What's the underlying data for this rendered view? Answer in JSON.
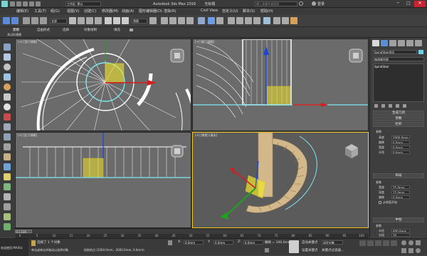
{
  "title_bar": {
    "app_title": "Autodesk 3ds Max 2016",
    "file_name": "无标题",
    "workspace": "工作区: 默认",
    "search_placeholder": "键入关键字或短语",
    "login": "登录",
    "window_controls": [
      "─",
      "□",
      "✕"
    ]
  },
  "menu": {
    "items": [
      "编辑(E)",
      "工具(T)",
      "组(G)",
      "视图(V)",
      "创建(C)",
      "修改器(M)",
      "动画(A)",
      "图形编辑器(D)",
      "渲染(R)",
      "Civil View",
      "自定义(U)",
      "脚本(S)",
      "帮助(H)"
    ]
  },
  "toolbar": {
    "dropdown_value": "全部",
    "view_dropdown": "视图"
  },
  "ribbon": {
    "tabs": [
      "建模",
      "自由形式",
      "选择",
      "对象绘制",
      "填充"
    ],
    "sub_label": "多边形建模"
  },
  "viewports": {
    "top_left": "[+] [顶] [线框]",
    "top_right": "[+] [前] [线框]",
    "bottom_left": "[+] [左] [线框]",
    "bottom_right": "[+] [透视] [真实]"
  },
  "command_panel": {
    "object_name": "SpiralStair001",
    "modifier_list": "修改器列表",
    "stack_item": "SpiralStair",
    "rollouts": {
      "generate": "生成几何",
      "parameters": "参数",
      "stringers": "栏杆",
      "layout": "布局",
      "center_pole": "中柱"
    },
    "params_group": "参数",
    "params": [
      {
        "label": "高度",
        "value": "1000.0mm"
      },
      {
        "label": "偏移",
        "value": "0.0mm"
      },
      {
        "label": "宽度",
        "value": "0.0mm"
      },
      {
        "label": "半径",
        "value": "0.0mm"
      }
    ],
    "layout_group": "参数",
    "layout_params": [
      {
        "label": "宽度",
        "value": "25.0mm"
      },
      {
        "label": "深度",
        "value": "15.0mm"
      },
      {
        "label": "偏移",
        "value": "0.0mm"
      }
    ],
    "checkbox_label": "从地面开始",
    "pole_group": "参数",
    "pole_params": [
      {
        "label": "半径",
        "value": "400.0mm"
      },
      {
        "label": "分段",
        "value": "16"
      }
    ]
  },
  "timeslider": {
    "frame_display": "0 / 100",
    "ticks": [
      "0",
      "5",
      "10",
      "15",
      "20",
      "25",
      "30",
      "35",
      "40",
      "45",
      "50",
      "55",
      "60",
      "65",
      "70",
      "75",
      "80",
      "85",
      "90",
      "95",
      "100"
    ]
  },
  "status": {
    "welcome": "欢迎使用 MAXSc",
    "selected": "选择了 1 个对象",
    "prompt": "单击或单击并拖动以选择对象",
    "coords_label": "拾取的点 (2000.0mm, -2000.0mm, 0.0mm)",
    "x_label": "X:",
    "x_value": "0.0mm",
    "y_label": "Y:",
    "y_value": "0.0mm",
    "z_label": "Z:",
    "z_value": "0.0mm",
    "grid": "栅格 = 100.0mm",
    "autokey": "自动关键点",
    "selection_set": "选定对象",
    "set_key": "设置关键点",
    "key_filters": "关键点过滤器..."
  },
  "colors": {
    "viewport_bg": "#6b6b6b",
    "active_border": "#f2c31a",
    "stair_wood": "#d2b88a",
    "highlight_cyan": "#7ee8f2",
    "axis_red": "#d81c1c",
    "axis_green": "#1ea31e",
    "axis_blue": "#1844d8",
    "gizmo_yellow": "#f2e52c"
  }
}
